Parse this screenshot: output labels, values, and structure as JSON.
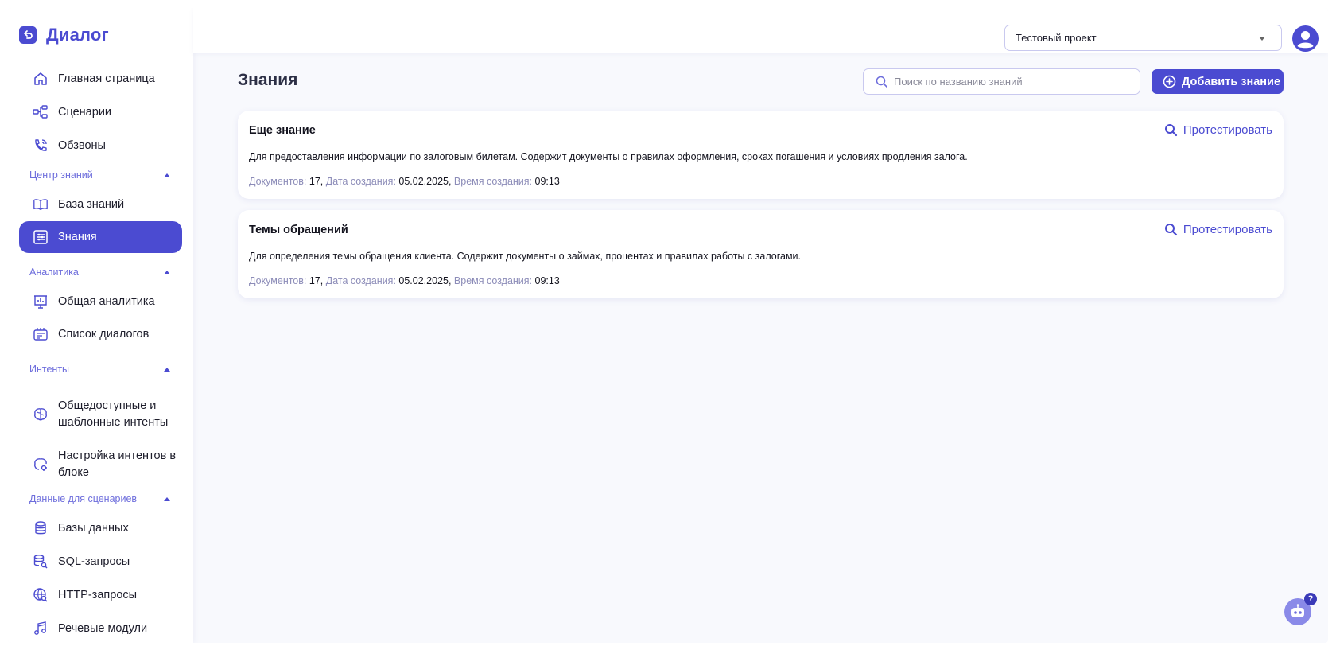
{
  "app": {
    "name": "Диалог"
  },
  "sidebar": {
    "items": [
      {
        "label": "Главная страница",
        "icon": "home-icon"
      },
      {
        "label": "Сценарии",
        "icon": "flow-icon"
      },
      {
        "label": "Обзвоны",
        "icon": "phone-icon"
      },
      {
        "label": "База знаний",
        "icon": "book-icon"
      },
      {
        "label": "Знания",
        "icon": "knowledge-icon",
        "active": true
      },
      {
        "label": "Общая аналитика",
        "icon": "analytics-icon"
      },
      {
        "label": "Список диалогов",
        "icon": "dialogs-icon"
      },
      {
        "label": "Общедоступные и шаблонные интенты",
        "icon": "brain-icon"
      },
      {
        "label": "Настройка интентов в блоке",
        "icon": "brain-gear-icon"
      },
      {
        "label": "Базы данных",
        "icon": "database-icon"
      },
      {
        "label": "SQL-запросы",
        "icon": "sql-icon"
      },
      {
        "label": "HTTP-запросы",
        "icon": "globe-search-icon"
      },
      {
        "label": "Речевые модули",
        "icon": "music-icon"
      }
    ],
    "sections": [
      {
        "label": "Центр знаний"
      },
      {
        "label": "Аналитика"
      },
      {
        "label": "Интенты"
      },
      {
        "label": "Данные для сценариев"
      }
    ]
  },
  "header": {
    "project": "Тестовый проект"
  },
  "main": {
    "title": "Знания",
    "search_placeholder": "Поиск по названию знаний",
    "add_label": "Добавить знание",
    "cards": [
      {
        "title": "Еще знание",
        "description": "Для предоставления информации по залоговым билетам. Содержит документы о правилах оформления, сроках погашения и условиях продления залога.",
        "docs_label": "Документов:",
        "docs_value": "17",
        "date_label": "Дата создания:",
        "date_value": "05.02.2025",
        "time_label": "Время создания:",
        "time_value": "09:13",
        "test_label": "Протестировать"
      },
      {
        "title": "Темы обращений",
        "description": "Для определения темы обращения клиента. Содержит документы о займах, процентах и правилах работы с залогами.",
        "docs_label": "Документов:",
        "docs_value": "17",
        "date_label": "Дата создания:",
        "date_value": "05.02.2025",
        "time_label": "Время создания:",
        "time_value": "09:13",
        "test_label": "Протестировать"
      }
    ]
  },
  "help": {
    "badge": "?"
  },
  "colors": {
    "accent": "#4b4bd1",
    "muted_label": "#8c8cb8",
    "section": "#6d6ddc"
  }
}
